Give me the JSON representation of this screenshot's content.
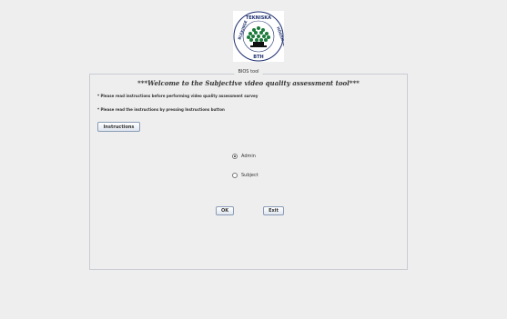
{
  "logo": {
    "top_text": "TEKNISKA",
    "left_text": "BLEKINGE",
    "right_text": "HÖGSKOLA",
    "bottom_text": "BTH"
  },
  "panel": {
    "title": "BIOS tool",
    "welcome": "***Welcome to the Subjective video quality assessment tool***",
    "instruction_1": "* Please read instructions before performing video quality assessment survey",
    "instruction_2": "* Please read the instructions by pressing Instructions button",
    "instructions_button": "Instructions",
    "radio_admin": "Admin",
    "radio_subject": "Subject",
    "selected_role": "Admin",
    "ok_button": "OK",
    "exit_button": "Exit"
  }
}
